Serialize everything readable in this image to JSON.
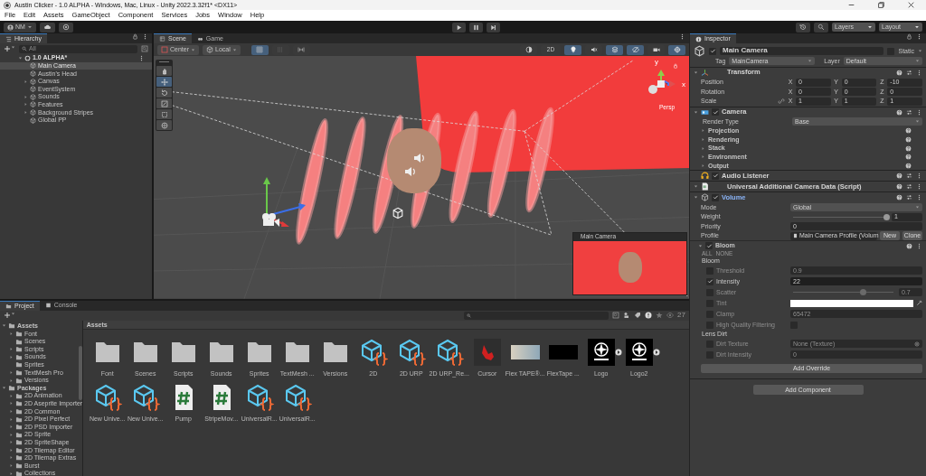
{
  "window": {
    "title": "Austin Clicker - 1.0 ALPHA - Windows, Mac, Linux - Unity 2022.3.32f1* <DX11>"
  },
  "menu": [
    "File",
    "Edit",
    "Assets",
    "GameObject",
    "Component",
    "Services",
    "Jobs",
    "Window",
    "Help"
  ],
  "toolbar": {
    "account": "NM",
    "layers": "Layers",
    "layout": "Layout"
  },
  "hierarchy": {
    "title": "Hierarchy",
    "search_placeholder": "All",
    "scene": "1.0 ALPHA*",
    "items": [
      {
        "label": "Main Camera",
        "kind": "leaf",
        "selected": true
      },
      {
        "label": "Austin's Head",
        "kind": "leaf",
        "selected": false
      },
      {
        "label": "Canvas",
        "kind": "group",
        "selected": false
      },
      {
        "label": "EventSystem",
        "kind": "leaf",
        "selected": false
      },
      {
        "label": "Sounds",
        "kind": "group",
        "selected": false
      },
      {
        "label": "Features",
        "kind": "group",
        "selected": false
      },
      {
        "label": "Background Stripes",
        "kind": "group",
        "selected": false
      },
      {
        "label": "Global PP",
        "kind": "leaf",
        "selected": false
      }
    ]
  },
  "scene": {
    "tabs": [
      {
        "label": "Scene",
        "selected": true
      },
      {
        "label": "Game",
        "selected": false
      }
    ],
    "pivot": "Center",
    "space": "Local",
    "mode_2d": {
      "label": "2D",
      "on": false
    },
    "tools": [
      {
        "kind": "hand",
        "selected": false
      },
      {
        "kind": "move",
        "selected": true
      },
      {
        "kind": "rotate",
        "selected": false
      },
      {
        "kind": "scale",
        "selected": false
      },
      {
        "kind": "rect",
        "selected": false
      },
      {
        "kind": "transform",
        "selected": false
      }
    ],
    "view_toggles": [
      {
        "kind": "lighting",
        "on": true
      },
      {
        "kind": "audio",
        "on": false
      },
      {
        "kind": "effects",
        "on": true
      },
      {
        "kind": "visibility",
        "on": true
      },
      {
        "kind": "camera",
        "on": false
      },
      {
        "kind": "gizmos",
        "on": true
      }
    ],
    "axis_labels": [
      "y",
      "x"
    ],
    "projection": "Persp",
    "preview_title": "Main Camera"
  },
  "inspector": {
    "title": "Inspector",
    "object": {
      "name": "Main Camera",
      "active": true,
      "static_label": "Static",
      "static": false,
      "tag_label": "Tag",
      "tag": "MainCamera",
      "layer_label": "Layer",
      "layer": "Default"
    },
    "transform": {
      "title": "Transform",
      "rows": [
        {
          "label": "Position",
          "constrain_icon": false,
          "fields": [
            {
              "axis": "X",
              "value": "0"
            },
            {
              "axis": "Y",
              "value": "0"
            },
            {
              "axis": "Z",
              "value": "-10"
            }
          ]
        },
        {
          "label": "Rotation",
          "constrain_icon": false,
          "fields": [
            {
              "axis": "X",
              "value": "0"
            },
            {
              "axis": "Y",
              "value": "0"
            },
            {
              "axis": "Z",
              "value": "0"
            }
          ]
        },
        {
          "label": "Scale",
          "constrain_icon": true,
          "fields": [
            {
              "axis": "X",
              "value": "1"
            },
            {
              "axis": "Y",
              "value": "1"
            },
            {
              "axis": "Z",
              "value": "1"
            }
          ]
        }
      ]
    },
    "camera": {
      "title": "Camera",
      "enabled": true,
      "render_type_label": "Render Type",
      "render_type": "Base",
      "sections": [
        "Projection",
        "Rendering",
        "Stack",
        "Environment",
        "Output"
      ]
    },
    "audio_listener": {
      "title": "Audio Listener",
      "enabled": true
    },
    "camera_data": {
      "title": "Universal Additional Camera Data (Script)"
    },
    "volume": {
      "title": "Volume",
      "enabled": true,
      "mode_label": "Mode",
      "mode": "Global",
      "weight": {
        "label": "Weight",
        "level": 1,
        "value": "1"
      },
      "priority_label": "Priority",
      "priority": "0",
      "profile_label": "Profile",
      "profile": "Main Camera Profile (Volum",
      "new": "New",
      "clone": "Clone",
      "override": {
        "title": "Bloom",
        "enabled": true,
        "all": "ALL",
        "none": "NONE",
        "groups": [
          {
            "heading": "Bloom",
            "params": [
              {
                "kind": "field",
                "label": "Threshold",
                "override": false,
                "value": "0.9"
              },
              {
                "kind": "field",
                "label": "Intensity",
                "override": true,
                "value": "22"
              },
              {
                "kind": "slider",
                "label": "Scatter",
                "override": false,
                "level": 0.7,
                "value": "0.7"
              },
              {
                "kind": "color",
                "label": "Tint",
                "override": false,
                "color": "#ffffff"
              },
              {
                "kind": "field",
                "label": "Clamp",
                "override": false,
                "value": "65472"
              },
              {
                "kind": "toggle",
                "label": "High Quality Filtering",
                "override": false,
                "checked": false
              }
            ]
          },
          {
            "heading": "Lens Dirt",
            "params": [
              {
                "kind": "object",
                "label": "Dirt Texture",
                "override": false,
                "value": "None (Texture)"
              },
              {
                "kind": "field",
                "label": "Dirt Intensity",
                "override": false,
                "value": "0"
              }
            ]
          }
        ]
      },
      "add_override": "Add Override"
    },
    "add_component": "Add Component"
  },
  "project": {
    "tabs": [
      {
        "label": "Project",
        "selected": true
      },
      {
        "label": "Console",
        "selected": false
      }
    ],
    "count": "27",
    "breadcrumb": "Assets",
    "tree": [
      {
        "label": "Assets",
        "kind": "group",
        "expanded": true,
        "children": [
          {
            "label": "Font",
            "kind": "group",
            "expanded": false
          },
          {
            "label": "Scenes",
            "kind": "leaf"
          },
          {
            "label": "Scripts",
            "kind": "group",
            "expanded": false
          },
          {
            "label": "Sounds",
            "kind": "group",
            "expanded": false
          },
          {
            "label": "Sprites",
            "kind": "leaf"
          },
          {
            "label": "TextMesh Pro",
            "kind": "group",
            "expanded": false
          },
          {
            "label": "Versions",
            "kind": "group",
            "expanded": false
          }
        ]
      },
      {
        "label": "Packages",
        "kind": "group",
        "expanded": true,
        "children": [
          {
            "label": "2D Animation",
            "kind": "group",
            "expanded": false
          },
          {
            "label": "2D Aseprite Importer",
            "kind": "group",
            "expanded": false
          },
          {
            "label": "2D Common",
            "kind": "group",
            "expanded": false
          },
          {
            "label": "2D Pixel Perfect",
            "kind": "group",
            "expanded": false
          },
          {
            "label": "2D PSD Importer",
            "kind": "group",
            "expanded": false
          },
          {
            "label": "2D Sprite",
            "kind": "group",
            "expanded": false
          },
          {
            "label": "2D SpriteShape",
            "kind": "group",
            "expanded": false
          },
          {
            "label": "2D Tilemap Editor",
            "kind": "group",
            "expanded": false
          },
          {
            "label": "2D Tilemap Extras",
            "kind": "group",
            "expanded": false
          },
          {
            "label": "Burst",
            "kind": "group",
            "expanded": false
          },
          {
            "label": "Collections",
            "kind": "group",
            "expanded": false
          }
        ]
      }
    ],
    "assets": [
      {
        "kind": "folder",
        "label": "Font"
      },
      {
        "kind": "folder",
        "label": "Scenes"
      },
      {
        "kind": "folder",
        "label": "Scripts"
      },
      {
        "kind": "folder",
        "label": "Sounds"
      },
      {
        "kind": "folder",
        "label": "Sprites"
      },
      {
        "kind": "folder",
        "label": "TextMesh ..."
      },
      {
        "kind": "folder",
        "label": "Versions"
      },
      {
        "kind": "asset",
        "label": "2D"
      },
      {
        "kind": "asset",
        "label": "2D URP"
      },
      {
        "kind": "asset",
        "label": "2D URP_Re..."
      },
      {
        "kind": "image",
        "label": "Cursor"
      },
      {
        "kind": "photo",
        "label": "Flex TAPE®..."
      },
      {
        "kind": "video",
        "label": "FlexTape ..."
      },
      {
        "kind": "sprite",
        "label": "Logo"
      },
      {
        "kind": "sprite",
        "label": "Logo2"
      },
      {
        "kind": "asset",
        "label": "New Unive..."
      },
      {
        "kind": "asset",
        "label": "New Unive..."
      },
      {
        "kind": "script",
        "label": "Pump"
      },
      {
        "kind": "script",
        "label": "StripeMov..."
      },
      {
        "kind": "asset",
        "label": "UniversalR..."
      },
      {
        "kind": "asset",
        "label": "UniversalR..."
      }
    ]
  }
}
